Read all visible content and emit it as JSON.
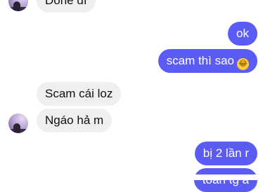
{
  "chat": {
    "messages": [
      {
        "side": "in",
        "text": "Done dĩ"
      },
      {
        "side": "out",
        "text": "ok"
      },
      {
        "side": "out",
        "text": "scam thì sao",
        "emoji": "😂"
      },
      {
        "side": "in",
        "text": "Scam cái loz"
      },
      {
        "side": "in",
        "text": "Ngáo hả m"
      },
      {
        "side": "out",
        "text": "bị 2 lần r"
      },
      {
        "side": "out",
        "text": "toàn tg à"
      }
    ],
    "colors": {
      "outgoing": "#5b5cf6",
      "incoming": "#efeff2"
    }
  }
}
